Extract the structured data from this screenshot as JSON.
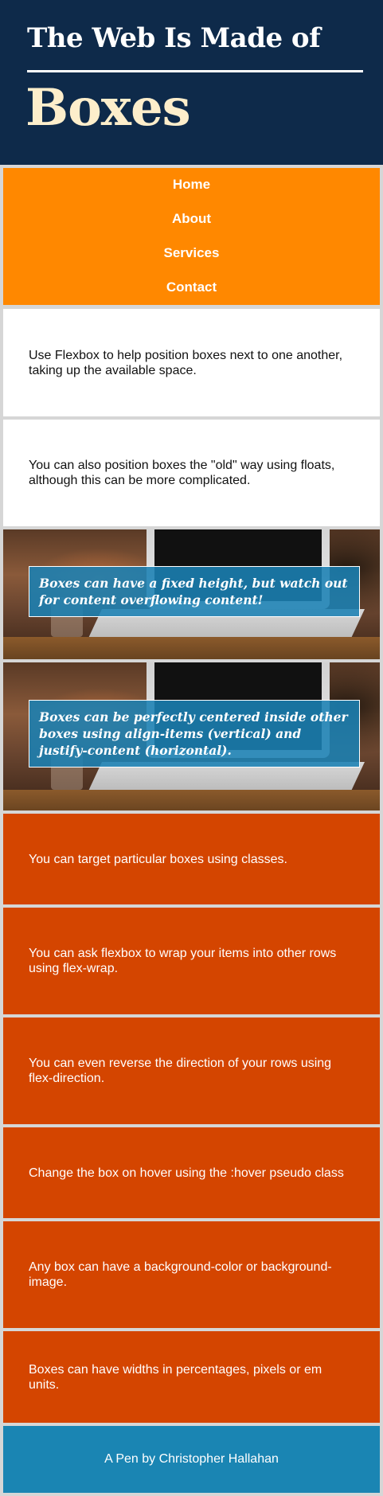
{
  "header": {
    "title_small": "The Web Is Made of",
    "title_big": "Boxes"
  },
  "nav": {
    "items": [
      {
        "label": "Home"
      },
      {
        "label": "About"
      },
      {
        "label": "Services"
      },
      {
        "label": "Contact"
      }
    ]
  },
  "boxes": [
    {
      "text": "Use Flexbox to help position boxes next to one another, taking up the available space."
    },
    {
      "text": "You can also position boxes the \"old\" way using floats, although this can be more complicated."
    },
    {
      "text": "Boxes can have a fixed height, but watch out for content overflowing content!"
    },
    {
      "text": "Boxes can be perfectly centered inside other boxes using align-items (vertical) and justify-content (horizontal)."
    },
    {
      "text": "You can target particular boxes using classes."
    },
    {
      "text": "You can ask flexbox to wrap your items into other rows using flex-wrap."
    },
    {
      "text": "You can even reverse the direction of your rows using flex-direction."
    },
    {
      "text": "Change the box on hover using the :hover pseudo class"
    },
    {
      "text": "Any box can have a background-color or background-image."
    },
    {
      "text": "Boxes can have widths in percentages, pixels or em units."
    }
  ],
  "footer": {
    "text": "A Pen by Christopher Hallahan"
  },
  "colors": {
    "header_bg": "#0e2a4a",
    "nav_bg": "#ff8800",
    "orange_box_bg": "#d44500",
    "overlay_bg": "#1a81b4",
    "footer_bg": "#1a85b3",
    "title_accent": "#fdeecb"
  }
}
